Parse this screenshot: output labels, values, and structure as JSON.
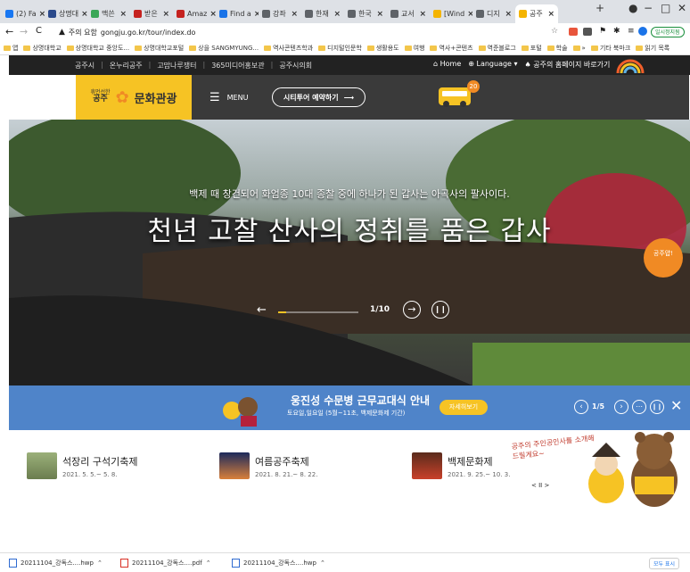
{
  "browser": {
    "tabs": [
      {
        "label": "(2) Fa",
        "color": "#1877f2"
      },
      {
        "label": "상명대",
        "color": "#2b4a8b"
      },
      {
        "label": "맥쓴",
        "color": "#3aa757"
      },
      {
        "label": "받은",
        "color": "#c5221f"
      },
      {
        "label": "Amaz",
        "color": "#c5221f"
      },
      {
        "label": "Find a",
        "color": "#1a73e8"
      },
      {
        "label": "강좌",
        "color": "#5f6368"
      },
      {
        "label": "한재",
        "color": "#5f6368"
      },
      {
        "label": "한국",
        "color": "#5f6368"
      },
      {
        "label": "교서",
        "color": "#5f6368"
      },
      {
        "label": "[Wind",
        "color": "#f4b400"
      },
      {
        "label": "디지",
        "color": "#5f6368"
      },
      {
        "label": "공주",
        "color": "#f4b400"
      }
    ],
    "new_tab": "+",
    "window_controls": [
      "−",
      "□",
      "✕"
    ],
    "nav": {
      "back": "←",
      "forward": "→",
      "reload": "C"
    },
    "url_security": "주의 요함",
    "url": "gongju.go.kr/tour/index.do",
    "profile_badge": "일시정지됨",
    "bookmarks": [
      "앱",
      "상명대학교",
      "상명대학교 중앙도...",
      "상명대학교포털",
      "상을 SANGMYUNG...",
      "역사콘텐츠학과",
      "디지털인문학",
      "생활용도",
      "여행",
      "역사+콘텐츠",
      "역준블로그",
      "포털",
      "학술",
      "»",
      "기타 북마크",
      "읽기 목록"
    ]
  },
  "site": {
    "util_links": [
      "공주시",
      "온누리공주",
      "고맙나루쟁터",
      "365미디어홍보관",
      "공주시의회"
    ],
    "home": "Home",
    "language": "Language",
    "gongju_shortcut": "공주의 홈페이지 바로가기",
    "logo_small": "휴먼선한",
    "logo_city": "공주",
    "logo_main": "문화관광",
    "menu_label": "MENU",
    "citytour_btn": "시티투어 예약하기",
    "bus_badge": "20",
    "hero_caption": "백제 때 창건되어 화엄종 10대 종찰 중에 하나가 된 갑사는 아곡사의 팔사이다.",
    "hero_title": "천년 고찰 산사의 정취를 품은 갑사",
    "slide_counter": "1/10",
    "side_badge": "공주얍!",
    "notice_title": "웅진성 수문병 근무교대식 안내",
    "notice_sub": "토요일,일요일 (5월~11초, 백제문화제 기간)",
    "notice_btn": "자세히보기",
    "notice_counter": "1/5",
    "festivals": [
      {
        "title": "석장리 구석기축제",
        "date": "2021. 5. 5.~ 5. 8."
      },
      {
        "title": "여름공주축제",
        "date": "2021. 8. 21.~ 8. 22."
      },
      {
        "title": "백제문화제",
        "date": "2021. 9. 25.~ 10. 3."
      }
    ],
    "handwriting": "공주의 주인공인사를 소개해드릴게요~",
    "mascot_pager": "< II >"
  },
  "downloads": {
    "items": [
      "20211104_강독스....hwp",
      "20211104_강독스....pdf",
      "20211104_강독스....hwp"
    ],
    "show_all": "모두 표시"
  }
}
